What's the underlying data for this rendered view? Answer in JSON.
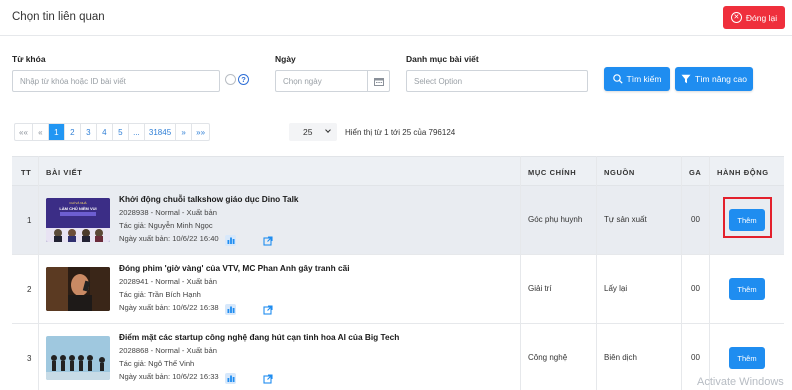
{
  "header": {
    "title": "Chọn tin liên quan",
    "close_label": "Đóng lại"
  },
  "filters": {
    "keyword_label": "Từ khóa",
    "keyword_placeholder": "Nhập từ khóa hoặc ID bài viết",
    "date_label": "Ngày",
    "date_placeholder": "Chọn ngày",
    "category_label": "Danh mục bài viết",
    "category_placeholder": "Select Option",
    "search_label": "Tìm kiếm",
    "advanced_label": "Tìm nâng cao"
  },
  "pagination": {
    "first": "««",
    "prev": "«",
    "pages": [
      "1",
      "2",
      "3",
      "4",
      "5",
      "...",
      "31845"
    ],
    "current": "1",
    "next": "»",
    "last": "»»",
    "per_page": "25",
    "info": "Hiển thị từ 1 tới 25 của 796124"
  },
  "table": {
    "headers": {
      "tt": "TT",
      "article": "BÀI VIẾT",
      "section": "MỤC CHÍNH",
      "source": "NGUỒN",
      "ga": "GA",
      "action": "HÀNH ĐỘNG"
    },
    "rows": [
      {
        "tt": "1",
        "title": "Khởi động chuỗi talkshow giáo dục Dino Talk",
        "meta": "2028938 - Normal - Xuất bản",
        "author": "Tác giả: Nguyễn Minh Ngọc",
        "published": "Ngày xuất bản: 10/6/22 16:40",
        "section": "Góc phụ huynh",
        "source": "Tự sản xuất",
        "ga": "00",
        "action": "Thêm"
      },
      {
        "tt": "2",
        "title": "Đóng phim 'giờ vàng' của VTV, MC Phan Anh gây tranh cãi",
        "meta": "2028941 - Normal - Xuất bản",
        "author": "Tác giả: Trần Bích Hạnh",
        "published": "Ngày xuất bản: 10/6/22 16:38",
        "section": "Giải trí",
        "source": "Lấy lại",
        "ga": "00",
        "action": "Thêm"
      },
      {
        "tt": "3",
        "title": "Điểm mặt các startup công nghệ đang hút cạn tinh hoa AI của Big Tech",
        "meta": "2028868 - Normal - Xuất bản",
        "author": "Tác giả: Ngô Thế Vinh",
        "published": "Ngày xuất bản: 10/6/22 16:33",
        "section": "Công nghệ",
        "source": "Biên dịch",
        "ga": "00",
        "action": "Thêm"
      }
    ]
  },
  "thumb_text": {
    "top": "CHỈ VÀ NHÀ",
    "mid": "LÀM CHỦ NIỀM VUI"
  },
  "watermark": "Activate Windows",
  "colors": {
    "primary": "#1f8df0",
    "danger": "#ef2f3c",
    "highlight_row": "#e9ecf1"
  }
}
